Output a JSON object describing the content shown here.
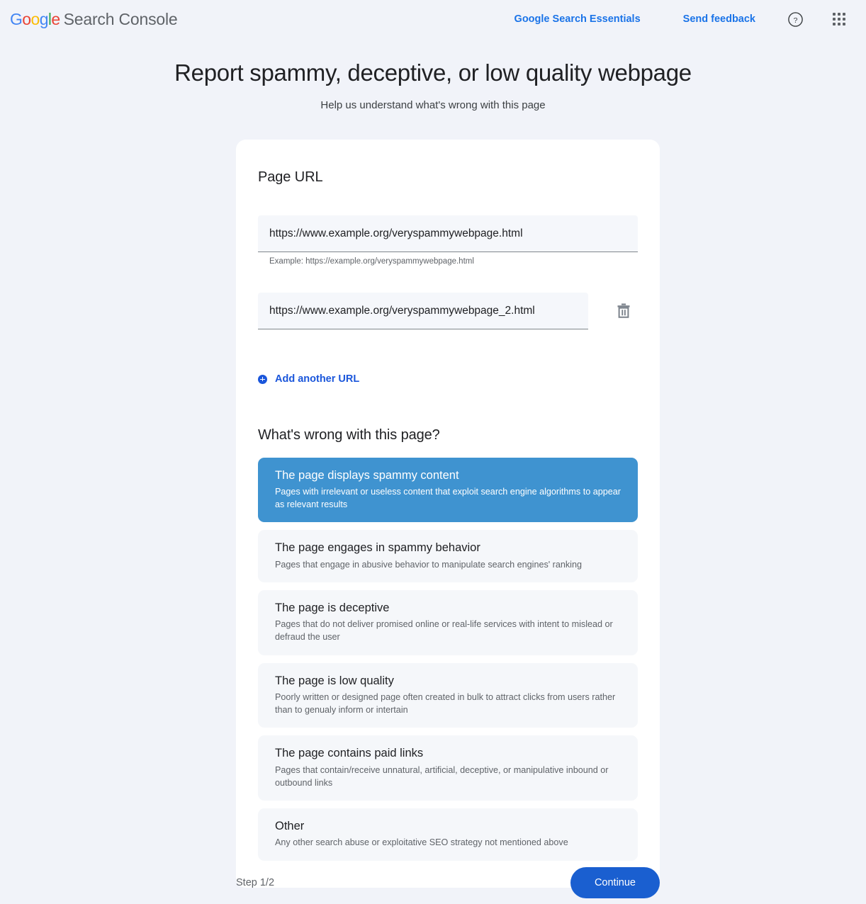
{
  "header": {
    "logo_text": "Google",
    "brand_suffix": "Search Console",
    "essentials_link": "Google Search Essentials",
    "feedback_link": "Send feedback",
    "help_icon": "help-circle-icon",
    "apps_icon": "apps-grid-icon",
    "colors": {
      "logo_blue": "#4285f4",
      "logo_red": "#ea4335",
      "logo_yellow": "#fbbc05",
      "logo_green": "#34a853",
      "link_blue": "#1a73e8"
    }
  },
  "page": {
    "title": "Report spammy, deceptive, or low quality webpage",
    "subtitle": "Help us understand what's wrong with this page"
  },
  "url_section": {
    "heading": "Page URL",
    "fields": [
      {
        "value": "https://www.example.org/veryspammywebpage.html",
        "placeholder": "https://www.example.org/veryspammywebpage.html",
        "hint": "Example: https://example.org/veryspammywebpage.html",
        "deletable": false
      },
      {
        "value": "https://www.example.org/veryspammywebpage_2.html",
        "placeholder": "https://www.example.org/veryspammywebpage_2.html",
        "hint": "",
        "deletable": true
      }
    ],
    "delete_icon": "trash-icon",
    "add_url_label": "Add another URL",
    "add_url_icon": "plus-circle-icon"
  },
  "question_section": {
    "heading": "What's wrong with this page?",
    "selected_index": 0,
    "selected_color": "#3f93d0",
    "options": [
      {
        "title": "The page displays spammy content",
        "description": "Pages with irrelevant or useless content that exploit search engine algorithms to appear as relevant results",
        "selected": true
      },
      {
        "title": "The page engages in spammy behavior",
        "description": "Pages that engage in abusive behavior to manipulate search engines' ranking",
        "selected": false
      },
      {
        "title": "The page is deceptive",
        "description": "Pages that do not deliver promised online or real-life services with intent to mislead or defraud the user",
        "selected": false
      },
      {
        "title": "The page is low quality",
        "description": "Poorly written or designed page often created in bulk to attract clicks from users rather than to genualy inform or intertain",
        "selected": false
      },
      {
        "title": "The page contains paid links",
        "description": "Pages that contain/receive unnatural, artificial, deceptive, or manipulative inbound or outbound links",
        "selected": false
      },
      {
        "title": "Other",
        "description": "Any other search abuse or exploitative SEO strategy not mentioned above",
        "selected": false
      }
    ]
  },
  "footer": {
    "step_label": "Step 1/2",
    "continue_label": "Continue",
    "continue_color": "#1a5fd0"
  }
}
